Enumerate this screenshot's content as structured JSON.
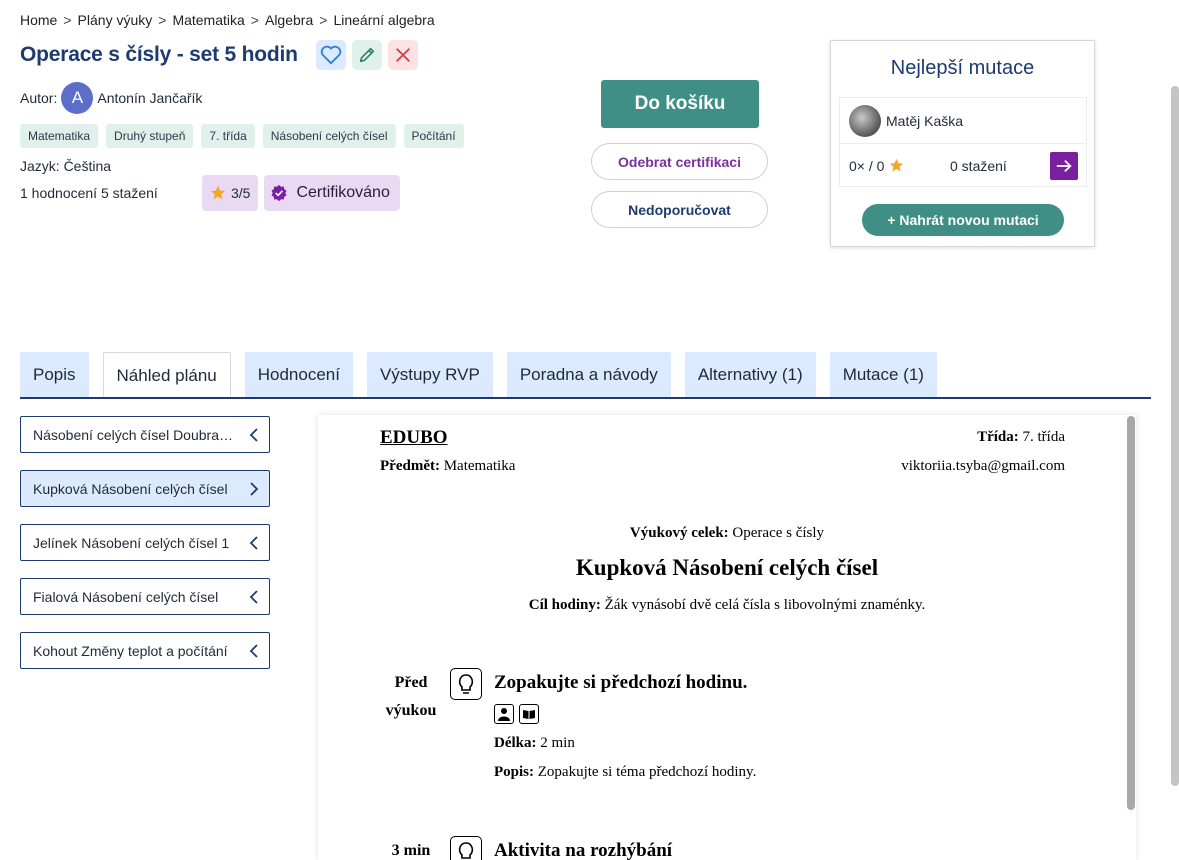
{
  "breadcrumb": [
    "Home",
    "Plány výuky",
    "Matematika",
    "Algebra",
    "Lineární algebra"
  ],
  "breadcrumb_sep": ">",
  "title": "Operace s čísly - set 5 hodin",
  "author": {
    "label": "Autor:",
    "initial": "A",
    "name": "Antonín Jančařík"
  },
  "tags": [
    "Matematika",
    "Druhý stupeň",
    "7. třída",
    "Násobení celých čísel",
    "Počítání"
  ],
  "language": "Jazyk: Čeština",
  "stats": {
    "ratings": "1 hodnocení",
    "downloads": "5 stažení",
    "score": "3/5",
    "certified": "Certifikováno"
  },
  "actions": {
    "cart": "Do košíku",
    "remove_cert": "Odebrat certifikaci",
    "not_recommend": "Nedoporučovat"
  },
  "mutations_panel": {
    "title": "Nejlepší mutace",
    "user": "Matěj Kaška",
    "rating": "0× / 0",
    "downloads": "0 stažení",
    "upload": "+ Nahrát novou mutaci"
  },
  "tabs": [
    "Popis",
    "Náhled plánu",
    "Hodnocení",
    "Výstupy RVP",
    "Poradna a návody",
    "Alternativy (1)",
    "Mutace (1)"
  ],
  "active_tab": "Náhled plánu",
  "sidebar": [
    "Násobení celých čísel Doubravová",
    "Kupková Násobení celých čísel",
    "Jelínek Násobení celých čísel 1",
    "Fialová Násobení celých čísel",
    "Kohout Změny teplot a počítání"
  ],
  "doc": {
    "brand": "EDUBO",
    "subject_label": "Předmět:",
    "subject": "Matematika",
    "grade_label": "Třída:",
    "grade": "7. třída",
    "email": "viktoriia.tsyba@gmail.com",
    "unit_label": "Výukový celek:",
    "unit": "Operace s čísly",
    "lesson_title": "Kupková Násobení celých čísel",
    "goal_label": "Cíl hodiny:",
    "goal": "Žák vynásobí dvě celá čísla s libovolnými znaménky.",
    "phase1": {
      "time": "Před výukou",
      "title": "Zopakujte si předchozí hodinu.",
      "length_label": "Délka:",
      "length": "2 min",
      "desc_label": "Popis:",
      "desc": "Zopakujte si téma předchozí hodiny."
    },
    "phase2": {
      "time": "3 min",
      "title": "Aktivita na rozhýbání"
    }
  },
  "colors": {
    "accent": "#3f8f86",
    "navy": "#1d3b6e",
    "purple": "#7b1fa2",
    "tab_bg": "#dbeafe",
    "tag_bg": "#dff1ea"
  }
}
